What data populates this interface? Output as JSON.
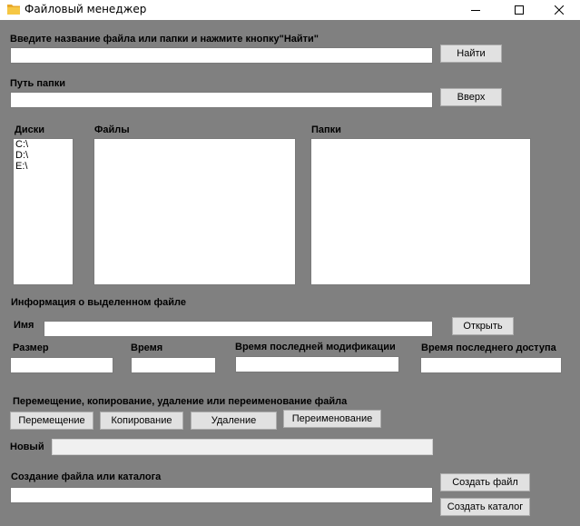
{
  "window": {
    "title": "Файловый менеджер",
    "icon": "folder-icon"
  },
  "search": {
    "label": "Введите название файла или папки и нажмите кнопку\"Найти\"",
    "value": "",
    "button": "Найти"
  },
  "path": {
    "label": "Путь папки",
    "value": "",
    "button": "Вверх"
  },
  "drives": {
    "label": "Диски",
    "items": [
      "C:\\",
      "D:\\",
      "E:\\"
    ]
  },
  "files": {
    "label": "Файлы",
    "items": []
  },
  "folders": {
    "label": "Папки",
    "items": []
  },
  "info": {
    "heading": "Информация о выделенном файле",
    "name_label": "Имя",
    "name_value": "",
    "open_button": "Открыть",
    "size_label": "Размер",
    "time_label": "Время",
    "modified_label": "Время последней модификации",
    "accessed_label": "Время последнего доступа"
  },
  "operations": {
    "heading": "Перемещение, копирование, удаление или переименование файла",
    "move": "Перемещение",
    "copy": "Копирование",
    "delete": "Удаление",
    "rename": "Переименование",
    "new_label": "Новый",
    "new_value": ""
  },
  "create": {
    "heading": "Создание файла или каталога",
    "value": "",
    "create_file": "Создать файл",
    "create_dir": "Создать каталог"
  },
  "colors": {
    "background": "#808080",
    "titlebar": "#ffffff",
    "folder": "#f6c744"
  }
}
